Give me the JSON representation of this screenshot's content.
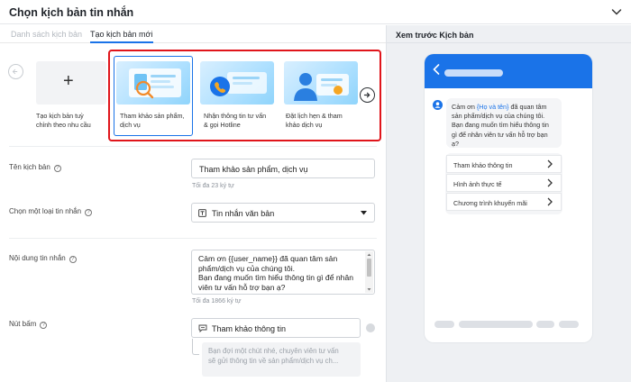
{
  "header": {
    "title": "Chọn kịch bản tin nhắn"
  },
  "tabs": [
    {
      "label": "Danh sách kịch bản"
    },
    {
      "label": "Tạo kịch bản mới"
    }
  ],
  "preview": {
    "title": "Xem trước Kịch bản"
  },
  "templates": {
    "new_label_1": "Tạo kịch bản tuỳ",
    "new_label_2": "chỉnh theo nhu cầu",
    "items": [
      {
        "line1": "Tham khảo sản phẩm,",
        "line2": "dịch vụ"
      },
      {
        "line1": "Nhận thông tin tư vấn",
        "line2": "& gọi Hotline"
      },
      {
        "line1": "Đặt lịch hẹn & tham",
        "line2": "khảo dịch vụ"
      }
    ]
  },
  "form": {
    "name_label": "Tên kịch bản",
    "name_value": "Tham khảo sản phẩm, dịch vụ",
    "name_hint": "Tối đa 23 ký tự",
    "type_label": "Chọn một loại tin nhắn",
    "type_value": "Tin nhắn văn bản",
    "content_label": "Nội dung tin nhắn",
    "content_line1": "Cảm ơn {{user_name}} đã quan tâm sản",
    "content_line2": "phẩm/dịch vụ của chúng tôi.",
    "content_line3": "Bạn đang muốn tìm hiểu thông tin gì để nhân",
    "content_line4": "viên tư vấn hỗ trợ bạn ạ?",
    "content_hint": "Tối đa 1866 ký tự",
    "button_label": "Nút bấm",
    "button_value": "Tham khảo thông tin",
    "reply_line1": "Bạn đợi một chút nhé, chuyên viên tư vấn",
    "reply_line2": "sẽ gửi thông tin về sản phẩm/dịch vụ ch..."
  },
  "phone": {
    "msg_pre": "Cảm ơn ",
    "msg_name": "{Họ và tên}",
    "msg_post1": " đã quan tâm",
    "msg_line2": "sản phẩm/dịch vụ của chúng tôi.",
    "msg_line3": "Bạn đang muốn tìm hiểu thông tin",
    "msg_line4": "gì để nhân viên tư vấn hỗ trợ bạn ạ?",
    "buttons": [
      "Tham khảo thông tin",
      "Hình ảnh thực tế",
      "Chương trình khuyến mãi"
    ]
  },
  "colors": {
    "accent": "#1a73e8",
    "highlight_border": "#e0151b"
  }
}
